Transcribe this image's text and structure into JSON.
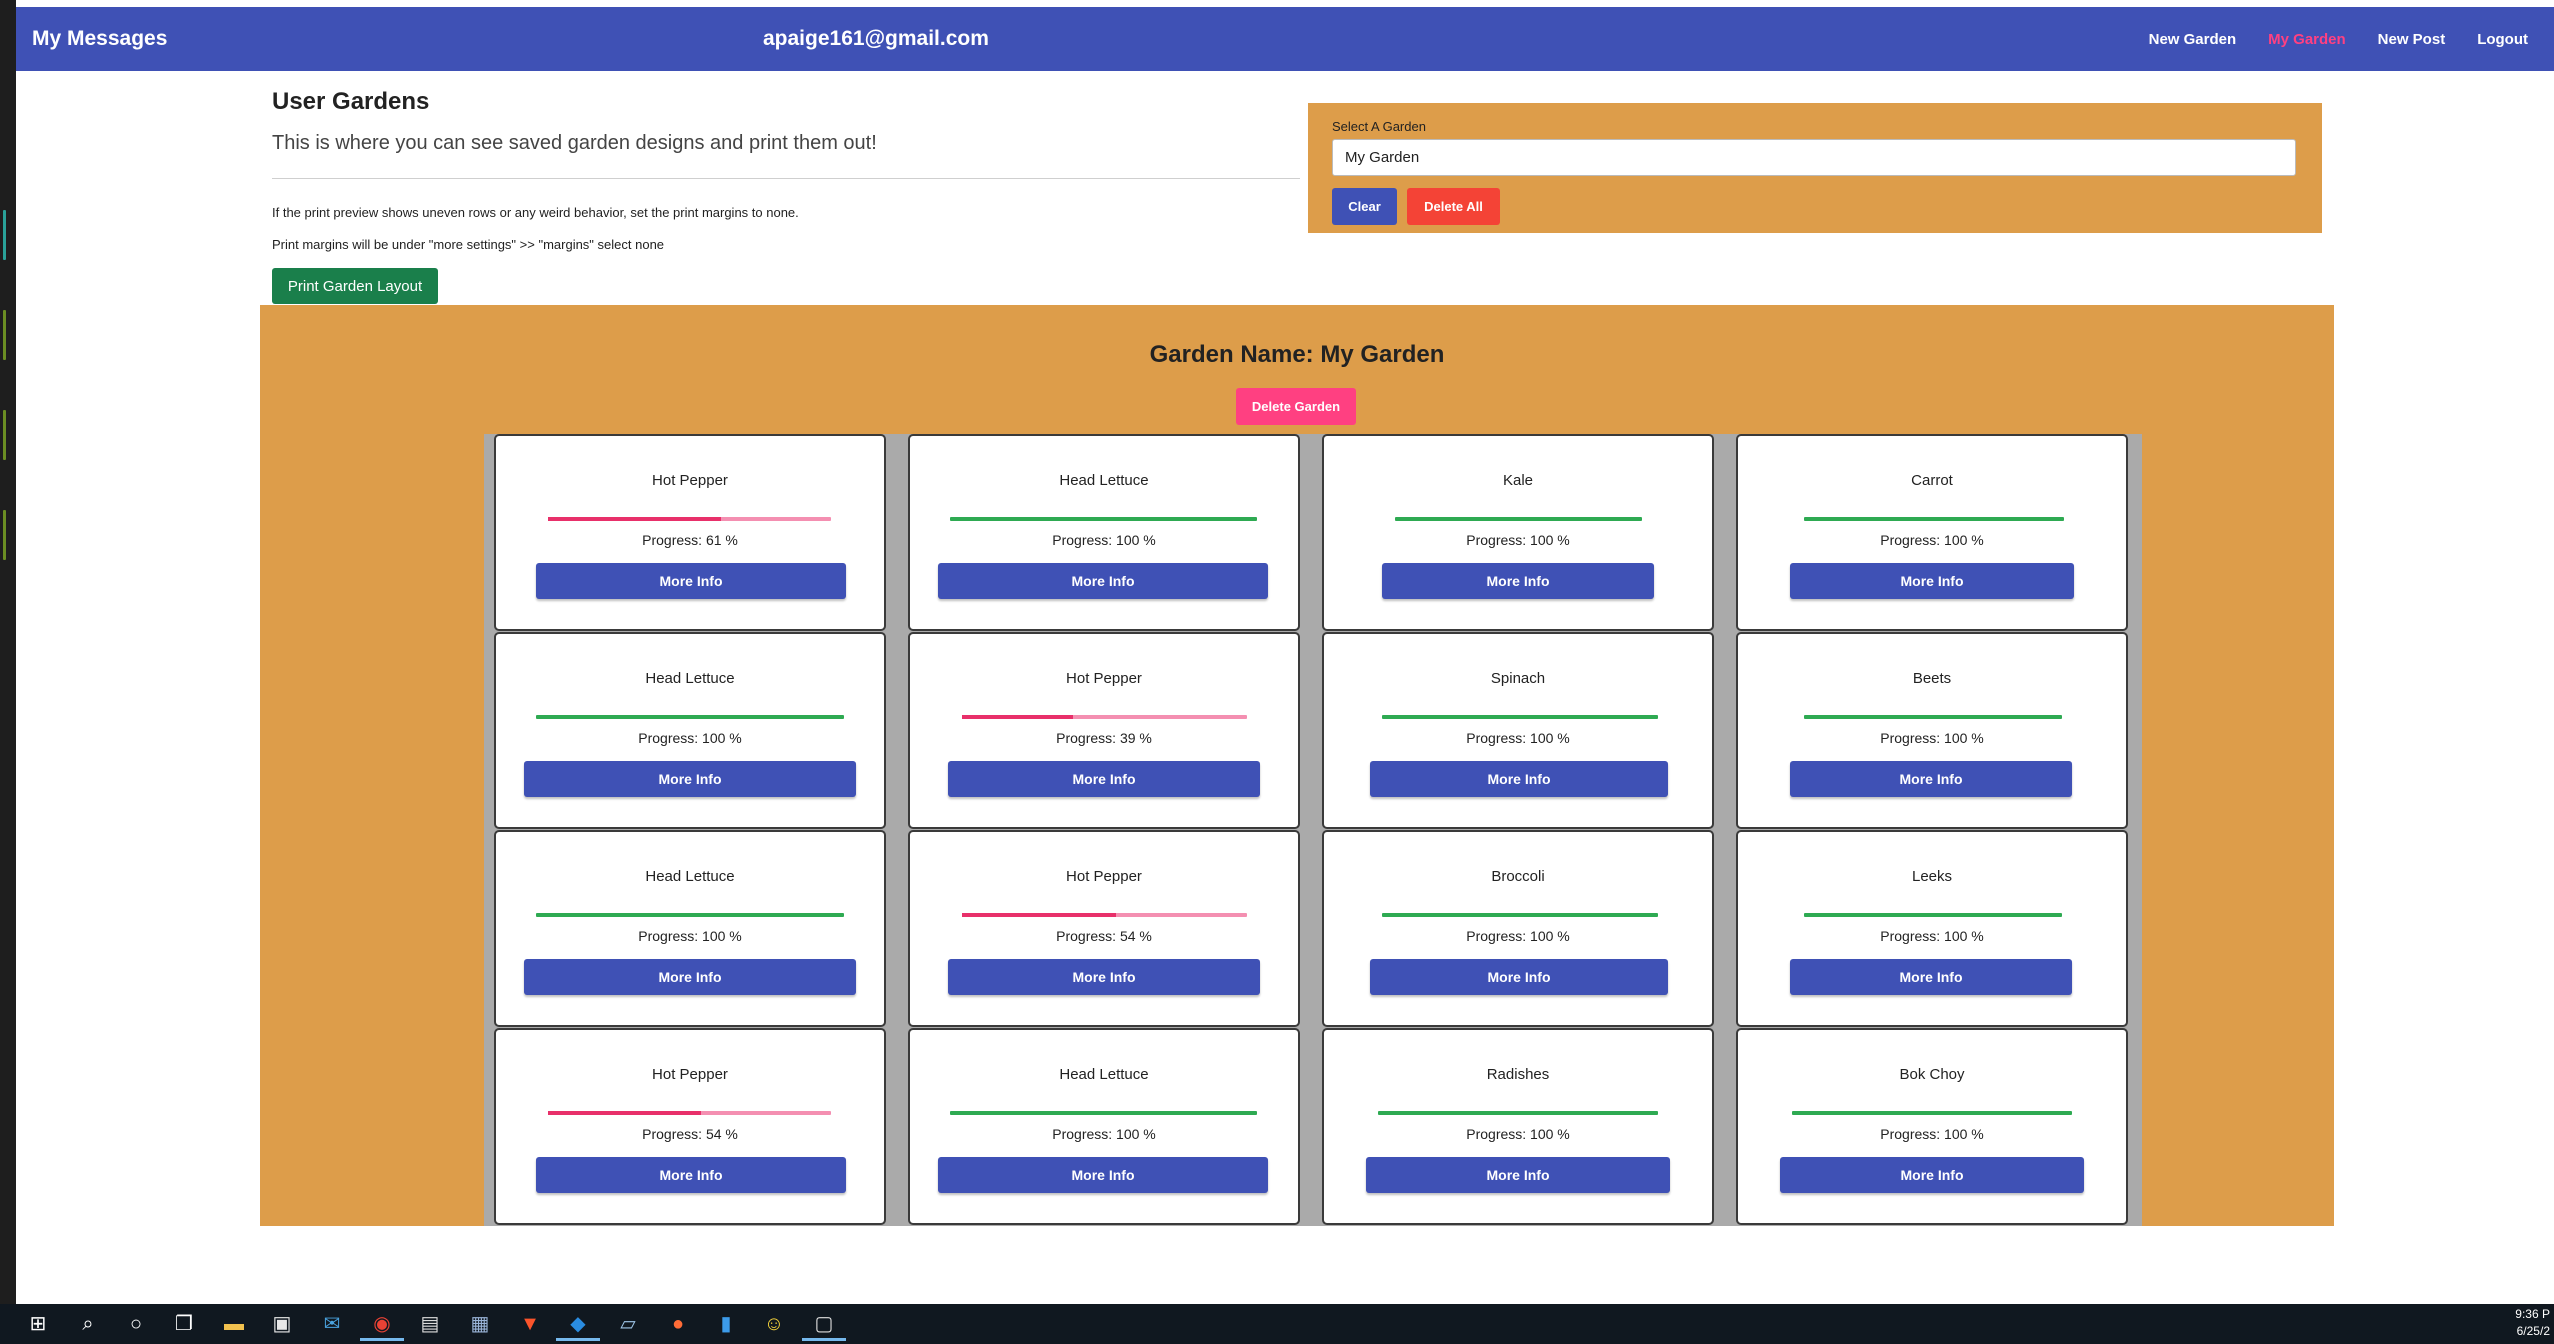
{
  "navbar": {
    "brand": "My Messages",
    "email": "apaige161@gmail.com",
    "links": [
      {
        "label": "New Garden",
        "active": false
      },
      {
        "label": "My Garden",
        "active": true
      },
      {
        "label": "New Post",
        "active": false
      },
      {
        "label": "Logout",
        "active": false
      }
    ]
  },
  "header": {
    "title": "User Gardens",
    "subtitle": "This is where you can see saved garden designs and print them out!",
    "note1": "If the print preview shows uneven rows or any weird behavior, set the print margins to none.",
    "note2": "Print margins will be under \"more settings\" >> \"margins\" select none",
    "print_button": "Print Garden Layout"
  },
  "select_panel": {
    "label": "Select A Garden",
    "value": "My Garden",
    "clear_button": "Clear",
    "delete_all_button": "Delete All"
  },
  "garden": {
    "name": "Garden Name: My Garden",
    "delete_button": "Delete Garden",
    "button_label": "More Info",
    "plants": [
      {
        "name": "Hot Pepper",
        "progress": 61,
        "progress_text": "Progress: 61 %"
      },
      {
        "name": "Head Lettuce",
        "progress": 100,
        "progress_text": "Progress: 100 %"
      },
      {
        "name": "Kale",
        "progress": 100,
        "progress_text": "Progress: 100 %"
      },
      {
        "name": "Carrot",
        "progress": 100,
        "progress_text": "Progress: 100 %"
      },
      {
        "name": "Head Lettuce",
        "progress": 100,
        "progress_text": "Progress: 100 %"
      },
      {
        "name": "Hot Pepper",
        "progress": 39,
        "progress_text": "Progress: 39 %"
      },
      {
        "name": "Spinach",
        "progress": 100,
        "progress_text": "Progress: 100 %"
      },
      {
        "name": "Beets",
        "progress": 100,
        "progress_text": "Progress: 100 %"
      },
      {
        "name": "Head Lettuce",
        "progress": 100,
        "progress_text": "Progress: 100 %"
      },
      {
        "name": "Hot Pepper",
        "progress": 54,
        "progress_text": "Progress: 54 %"
      },
      {
        "name": "Broccoli",
        "progress": 100,
        "progress_text": "Progress: 100 %"
      },
      {
        "name": "Leeks",
        "progress": 100,
        "progress_text": "Progress: 100 %"
      },
      {
        "name": "Hot Pepper",
        "progress": 54,
        "progress_text": "Progress: 54 %"
      },
      {
        "name": "Head Lettuce",
        "progress": 100,
        "progress_text": "Progress: 100 %"
      },
      {
        "name": "Radishes",
        "progress": 100,
        "progress_text": "Progress: 100 %"
      },
      {
        "name": "Bok Choy",
        "progress": 100,
        "progress_text": "Progress: 100 %"
      }
    ]
  },
  "colors": {
    "primary": "#3f51b5",
    "accent": "#ff4081",
    "warn": "#f44336",
    "garden_bg": "#dd9d4a",
    "print_button": "#1a7f4b",
    "progress_done": "#2eaa52",
    "progress_fill": "#e8306a",
    "progress_track": "#f48fb1"
  },
  "taskbar": {
    "icons": [
      "windows-start-icon",
      "search-icon",
      "cortana-icon",
      "task-view-icon",
      "file-explorer-icon",
      "store-icon",
      "mail-icon",
      "chrome-icon",
      "terminal-icon",
      "calculator-icon",
      "brave-icon",
      "vscode-icon",
      "notepad-icon",
      "postman-icon",
      "file-icon",
      "smiley-app-icon",
      "window-app-icon"
    ],
    "time": "9:36 P",
    "date": "6/25/2"
  }
}
